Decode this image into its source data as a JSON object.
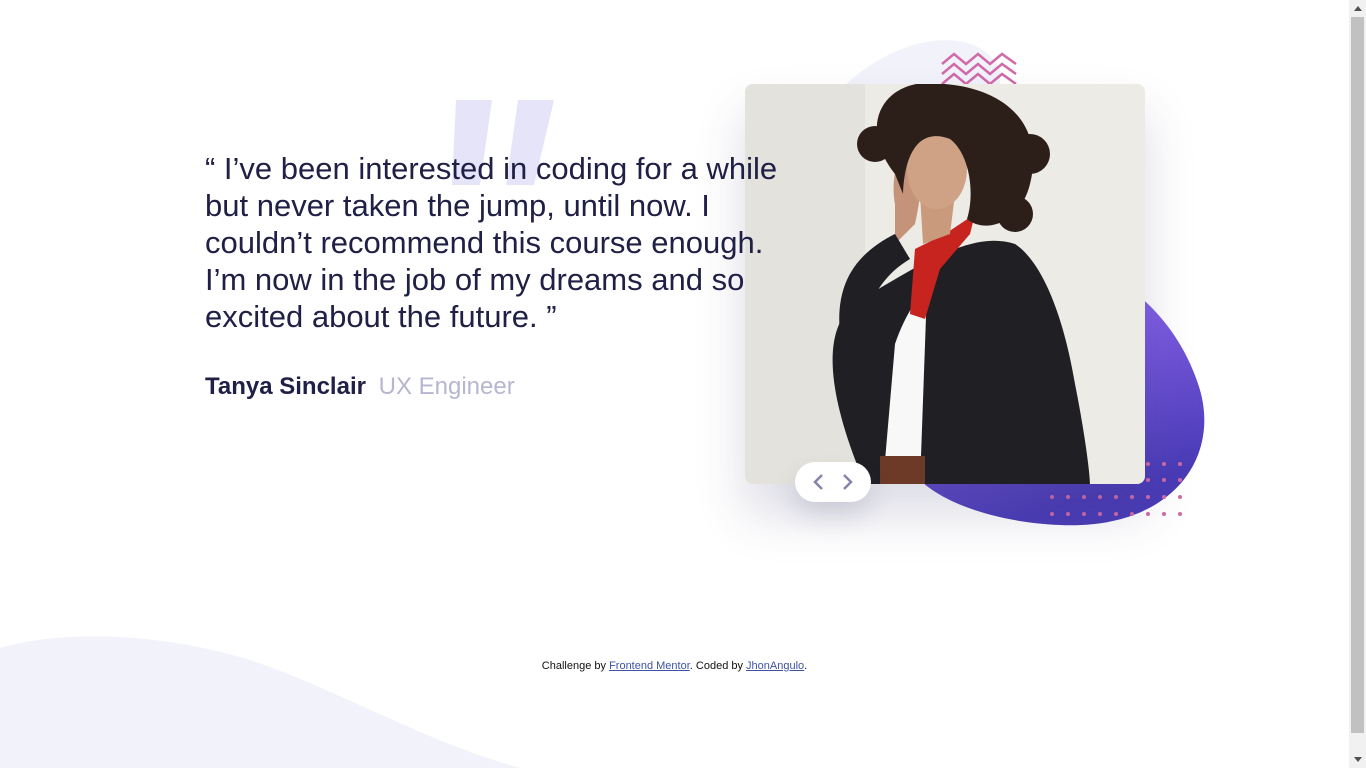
{
  "testimonial": {
    "quote": "“ I’ve been interested in coding for a while but never taken the jump, until now. I couldn’t recommend this course enough. I’m now in the job of my dreams and so excited about the future. ”",
    "author_name": "Tanya Sinclair",
    "author_role": "UX Engineer"
  },
  "navigation": {
    "prev_icon": "chevron-left-icon",
    "next_icon": "chevron-right-icon"
  },
  "footer": {
    "prefix": "Challenge by ",
    "link1": "Frontend Mentor",
    "middle": ". Coded by ",
    "link2": "JhonAngulo",
    "suffix": "."
  },
  "colors": {
    "text_dark": "#202046",
    "text_muted": "#b6b6d0",
    "blob_purple": "#6a4fd6",
    "accent_pink": "#d06aa9",
    "bg_light": "#f2f2fb"
  }
}
